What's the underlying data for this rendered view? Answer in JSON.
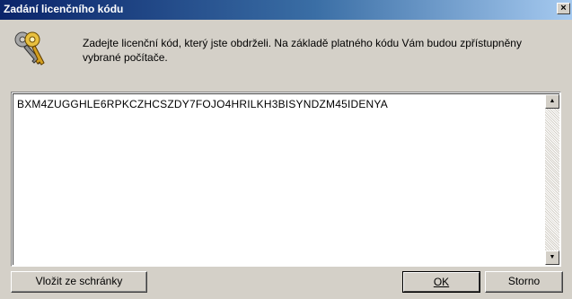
{
  "window": {
    "title": "Zadání licenčního kódu",
    "close_glyph": "×"
  },
  "icon": {
    "name": "keys-icon"
  },
  "description": "Zadejte licenční kód, který jste obdrželi. Na základě platného kódu Vám budou zpřístupněny vybrané počítače.",
  "license_code": "BXM4ZUGGHLE6RPKCZHCSZDY7FOJO4HRILKH3BISYNDZM45IDENYA",
  "buttons": {
    "paste": "Vložit ze schránky",
    "ok": "OK",
    "cancel": "Storno"
  },
  "scrollbar": {
    "up_glyph": "▲",
    "down_glyph": "▼"
  }
}
